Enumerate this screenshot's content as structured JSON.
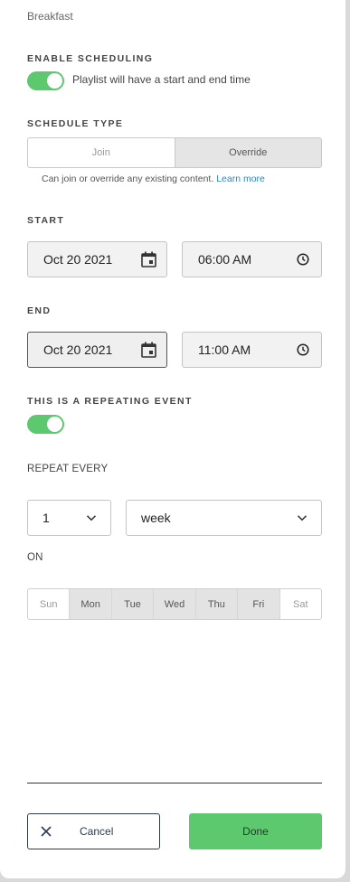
{
  "playlist_name": "Breakfast",
  "scheduling": {
    "label": "ENABLE SCHEDULING",
    "enabled": true,
    "description": "Playlist will have a start and end time"
  },
  "schedule_type": {
    "label": "SCHEDULE TYPE",
    "options": [
      "Join",
      "Override"
    ],
    "selected": "Override",
    "help_text": "Can join or override any existing content.",
    "learn_more": "Learn more"
  },
  "start": {
    "label": "START",
    "date": "Oct 20 2021",
    "time": "06:00 AM"
  },
  "end": {
    "label": "END",
    "date": "Oct 20 2021",
    "time": "11:00 AM"
  },
  "repeat": {
    "label": "THIS IS A REPEATING EVENT",
    "enabled": true,
    "every_label": "REPEAT EVERY",
    "interval": "1",
    "unit": "week",
    "on_label": "ON",
    "days": [
      {
        "label": "Sun",
        "selected": false
      },
      {
        "label": "Mon",
        "selected": true
      },
      {
        "label": "Tue",
        "selected": true
      },
      {
        "label": "Wed",
        "selected": true
      },
      {
        "label": "Thu",
        "selected": true
      },
      {
        "label": "Fri",
        "selected": true
      },
      {
        "label": "Sat",
        "selected": false
      }
    ]
  },
  "actions": {
    "cancel": "Cancel",
    "done": "Done"
  },
  "colors": {
    "accent_green": "#5cc96f",
    "link_blue": "#2e86c9",
    "navy": "#2b3a55"
  },
  "icons": {
    "date": "calendar-icon",
    "time": "clock-icon",
    "dropdown": "chevron-down-icon",
    "cancel": "close-icon"
  }
}
